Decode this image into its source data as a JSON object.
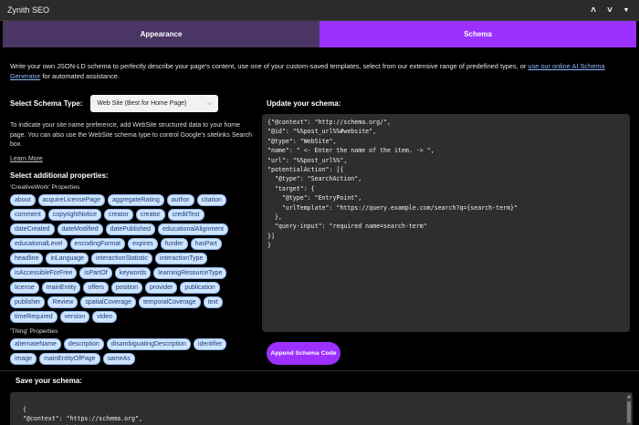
{
  "window": {
    "title": "Zynith SEO",
    "collapse_icon": "chevron-up-icon",
    "expand_icon": "chevron-down-icon"
  },
  "tabs": [
    {
      "label": "Appearance",
      "active": false
    },
    {
      "label": "Schema",
      "active": true
    }
  ],
  "intro": {
    "text": "Write your own JSON-LD schema to perfectly describe your page's content, use one of your custom-saved templates, select from our extensive range of predefined types, or ",
    "link": "use our online AI Schema Generator",
    "suffix": " for automated assistance."
  },
  "schema_type": {
    "label": "Select Schema Type:",
    "selected": "Web Site (Best for Home Page)"
  },
  "description": "To indicate your site name preference, add WebSite structured data to your home page. You can also use the WebSite schema type to control Google's sitelinks Search box.",
  "learn_more": "Learn More",
  "additional": {
    "label": "Select additional properties:",
    "creative_label": "'CreativeWork' Properties",
    "creative_tags": [
      "about",
      "acquireLicensePage",
      "aggregateRating",
      "author",
      "citation",
      "comment",
      "copyrightNotice",
      "creator",
      "creator",
      "creditText",
      "dateCreated",
      "dateModified",
      "datePublished",
      "educationalAlignment",
      "educationalLevel",
      "encodingFormat",
      "expires",
      "funder",
      "hasPart",
      "headline",
      "inLanguage",
      "interactionStatistic",
      "interactionType",
      "isAccessibleForFree",
      "isPartOf",
      "keywords",
      "learningResourceType",
      "license",
      "mainEntity",
      "offers",
      "position",
      "provider",
      "publication",
      "publisher",
      "Review",
      "spatialCoverage",
      "temporalCoverage",
      "text",
      "timeRequired",
      "version",
      "video"
    ],
    "thing_label": "'Thing' Properties",
    "thing_tags": [
      "alternateName",
      "description",
      "disambiguatingDescription",
      "identifier",
      "image",
      "mainEntityOfPage",
      "sameAs"
    ]
  },
  "update": {
    "label": "Update your schema:",
    "code": "{\"@context\": \"http://schema.org/\",\n\"@id\": \"%%post_url%%#website\",\n\"@type\": \"WebSite\",\n\"name\": \" <- Enter the name of the item. -> \",\n\"url\": \"%%post_url%%\",\n\"potentialAction\": [{\n  \"@type\": \"SearchAction\",\n  \"target\": {\n    \"@type\": \"EntryPoint\",\n    \"urlTemplate\": \"https://query.example.com/search?q={search-term}\"\n  },\n  \"query-input\": \"required name=search-term\"\n}]\n}"
  },
  "append_button": "Append Schema Code",
  "save": {
    "label": "Save your schema:",
    "code": "{\n  \"@context\": \"https://schema.org\",\n  \"@type\": \"WebSite\","
  },
  "colors": {
    "accent": "#9b30ff",
    "tab_inactive": "#4a3564",
    "tag_bg": "#cfe4ff",
    "code_bg": "#2e2e2e"
  }
}
